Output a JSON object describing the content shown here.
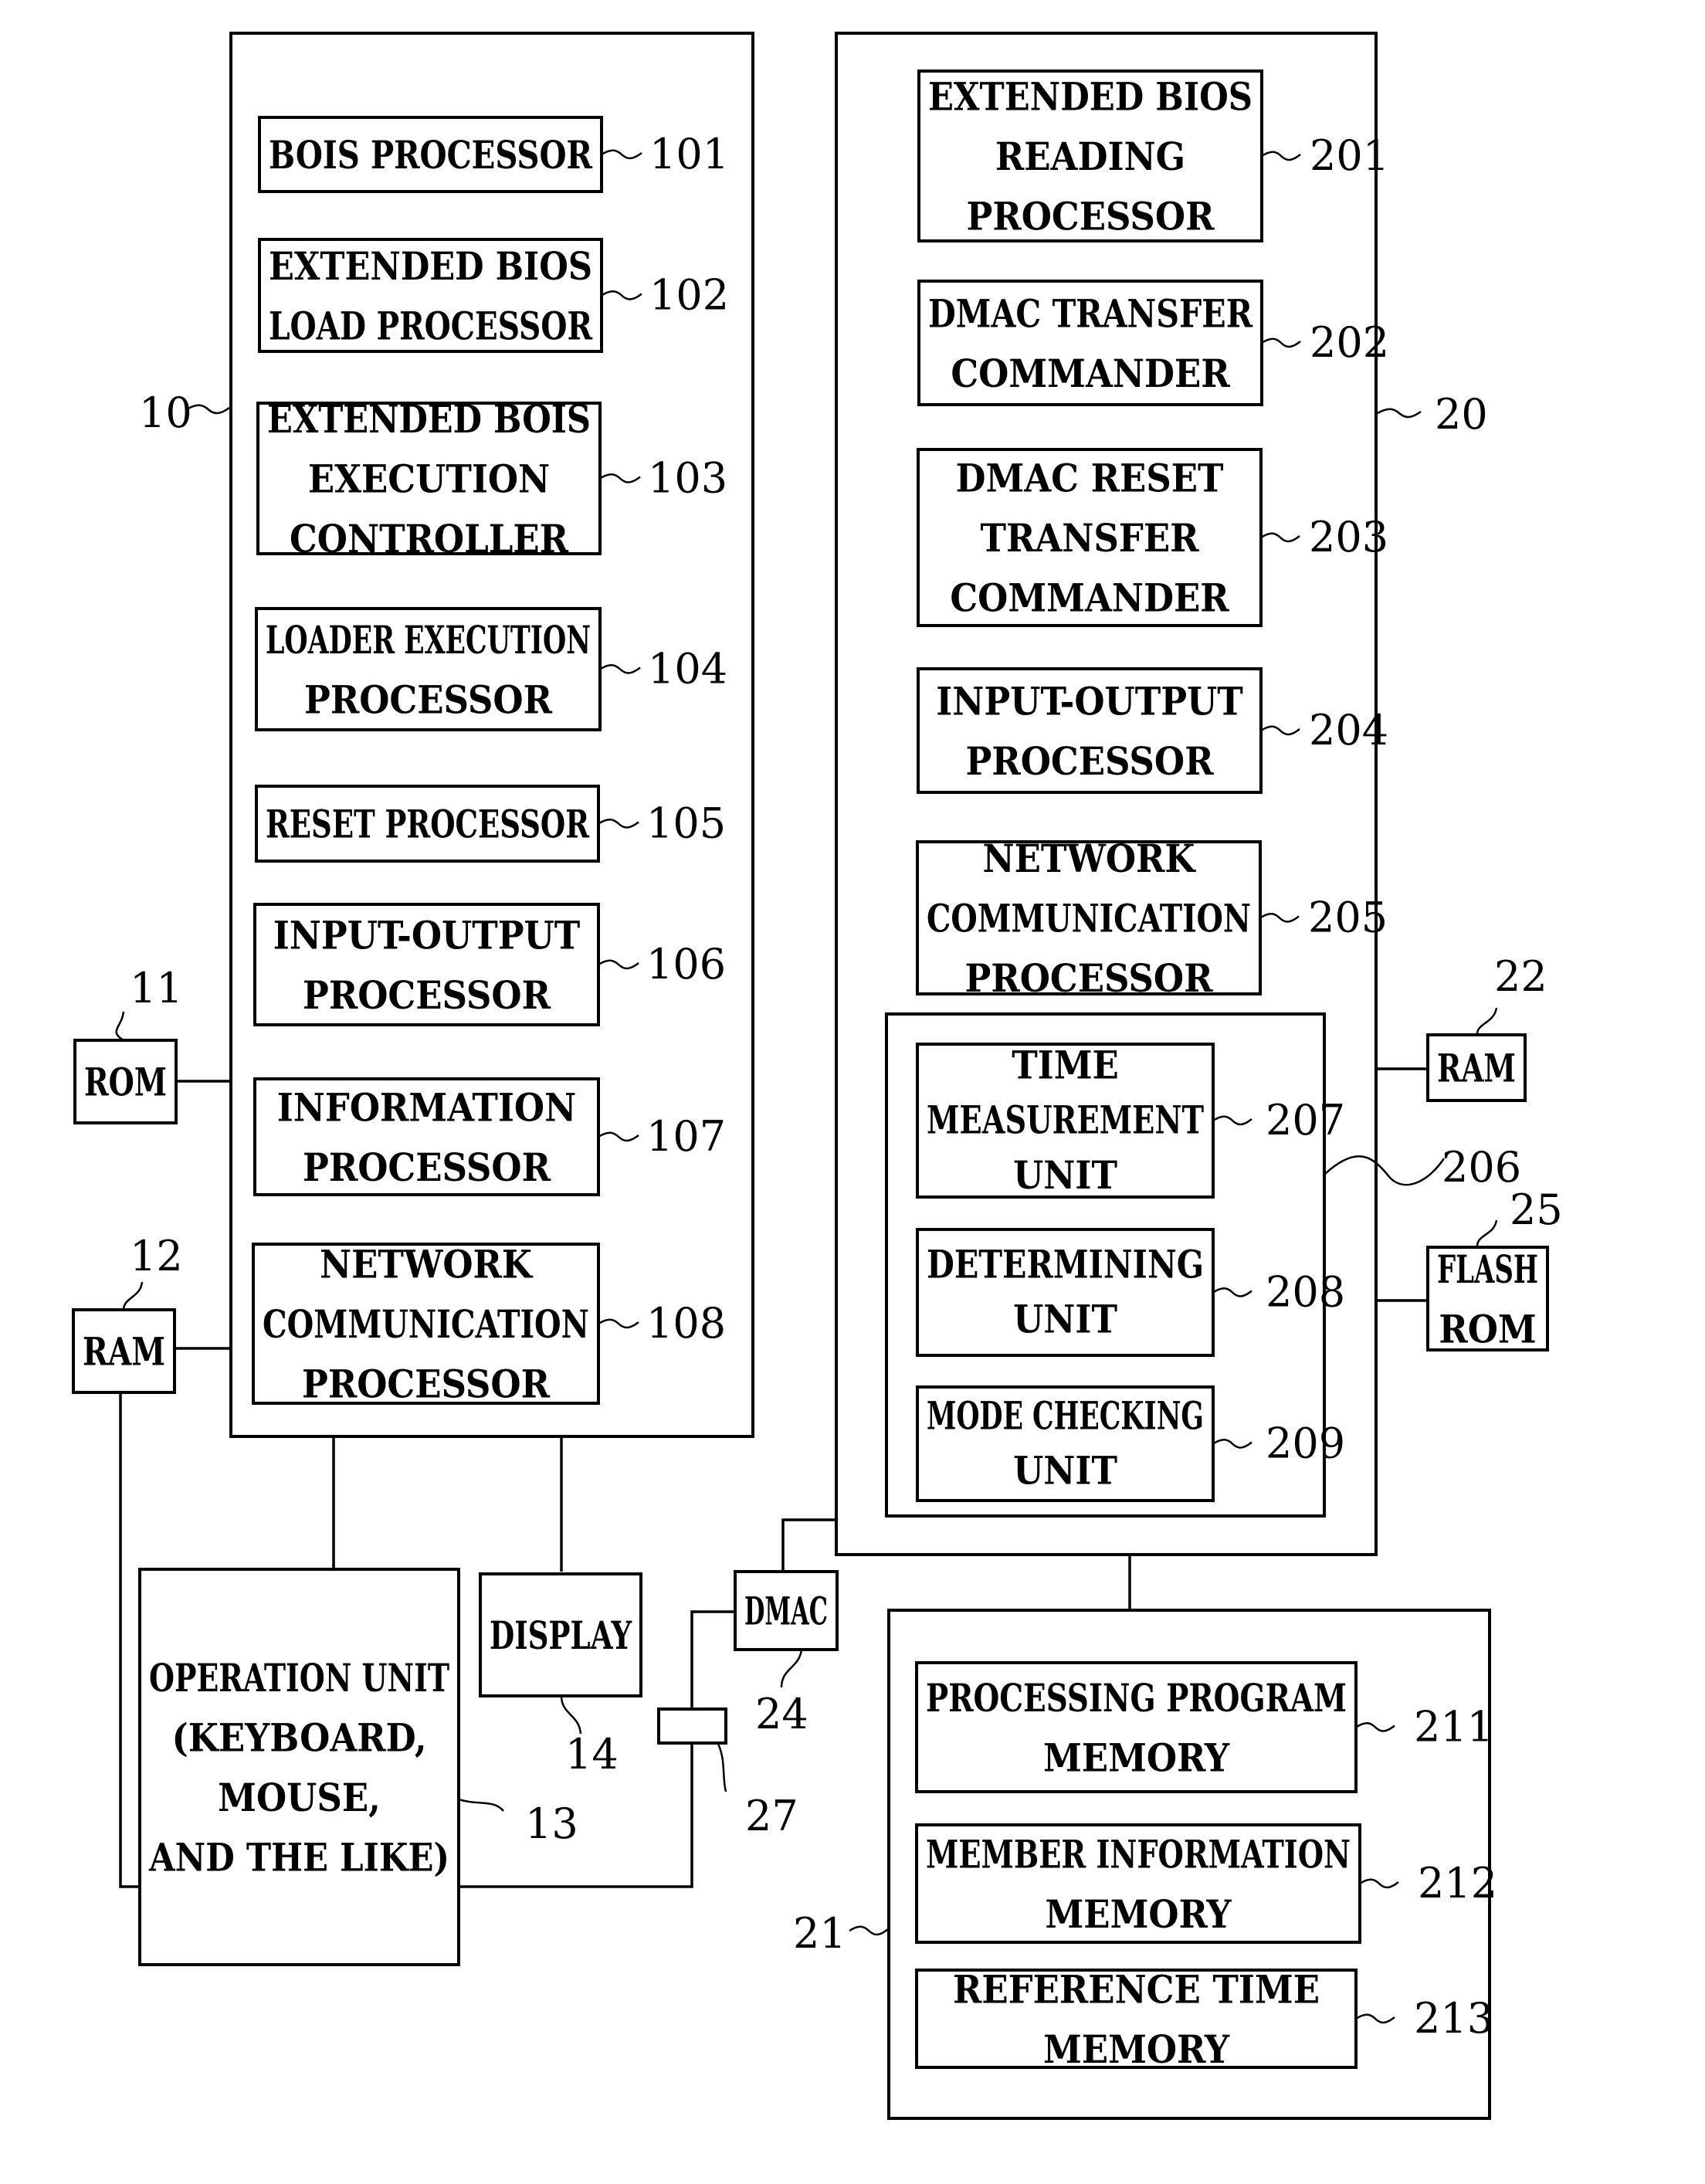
{
  "figure": {
    "units": {
      "computer_10": {
        "ref": "10",
        "blocks": [
          {
            "ref": "101",
            "lines": [
              "BOIS PROCESSOR"
            ]
          },
          {
            "ref": "102",
            "lines": [
              "EXTENDED BIOS",
              "LOAD PROCESSOR"
            ]
          },
          {
            "ref": "103",
            "lines": [
              "EXTENDED BOIS",
              "EXECUTION",
              "CONTROLLER"
            ]
          },
          {
            "ref": "104",
            "lines": [
              "LOADER EXECUTION",
              "PROCESSOR"
            ]
          },
          {
            "ref": "105",
            "lines": [
              "RESET PROCESSOR"
            ]
          },
          {
            "ref": "106",
            "lines": [
              "INPUT-OUTPUT",
              "PROCESSOR"
            ]
          },
          {
            "ref": "107",
            "lines": [
              "INFORMATION",
              "PROCESSOR"
            ]
          },
          {
            "ref": "108",
            "lines": [
              "NETWORK",
              "COMMUNICATION",
              "PROCESSOR"
            ]
          }
        ]
      },
      "processor_20": {
        "ref": "20",
        "blocks": [
          {
            "ref": "201",
            "lines": [
              "EXTENDED BIOS",
              "READING",
              "PROCESSOR"
            ]
          },
          {
            "ref": "202",
            "lines": [
              "DMAC TRANSFER",
              "COMMANDER"
            ]
          },
          {
            "ref": "203",
            "lines": [
              "DMAC RESET",
              "TRANSFER",
              "COMMANDER"
            ]
          },
          {
            "ref": "204",
            "lines": [
              "INPUT-OUTPUT",
              "PROCESSOR"
            ]
          },
          {
            "ref": "205",
            "lines": [
              "NETWORK",
              "COMMUNICATION",
              "PROCESSOR"
            ]
          }
        ],
        "group_206": {
          "ref": "206",
          "blocks": [
            {
              "ref": "207",
              "lines": [
                "TIME",
                "MEASUREMENT",
                "UNIT"
              ]
            },
            {
              "ref": "208",
              "lines": [
                "DETERMINING",
                "UNIT"
              ]
            },
            {
              "ref": "209",
              "lines": [
                "MODE CHECKING",
                "UNIT"
              ]
            }
          ]
        }
      },
      "memory_21": {
        "ref": "21",
        "blocks": [
          {
            "ref": "211",
            "lines": [
              "PROCESSING PROGRAM",
              "MEMORY"
            ]
          },
          {
            "ref": "212",
            "lines": [
              "MEMBER INFORMATION",
              "MEMORY"
            ]
          },
          {
            "ref": "213",
            "lines": [
              "REFERENCE TIME",
              "MEMORY"
            ]
          }
        ]
      }
    },
    "peripherals": {
      "rom_11": {
        "ref": "11",
        "lines": [
          "ROM"
        ]
      },
      "ram_12": {
        "ref": "12",
        "lines": [
          "RAM"
        ]
      },
      "operation_13": {
        "ref": "13",
        "lines": [
          "OPERATION UNIT",
          "(KEYBOARD,",
          "MOUSE,",
          "AND THE LIKE)"
        ]
      },
      "display_14": {
        "ref": "14",
        "lines": [
          "DISPLAY"
        ]
      },
      "ram_22": {
        "ref": "22",
        "lines": [
          "RAM"
        ]
      },
      "dmac_24": {
        "ref": "24",
        "lines": [
          "DMAC"
        ]
      },
      "flash_25": {
        "ref": "25",
        "lines": [
          "FLASH",
          "ROM"
        ]
      },
      "connector_27": {
        "ref": "27",
        "lines": []
      }
    }
  }
}
